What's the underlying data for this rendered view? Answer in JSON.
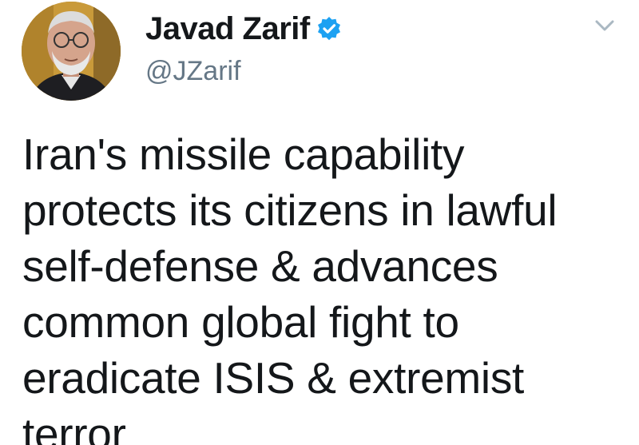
{
  "tweet": {
    "author": {
      "display_name": "Javad Zarif",
      "handle": "@JZarif",
      "verified": true,
      "avatar_icon": "user-avatar-photo"
    },
    "menu_icon": "chevron-down-icon",
    "text": "Iran's missile capability\nprotects its citizens in lawful\nself-defense & advances\ncommon global fight to\neradicate ISIS & extremist\nterror"
  },
  "colors": {
    "verified_badge": "#1da1f2",
    "name_text": "#14171a",
    "handle_text": "#657786",
    "caret": "#aab8c2"
  }
}
